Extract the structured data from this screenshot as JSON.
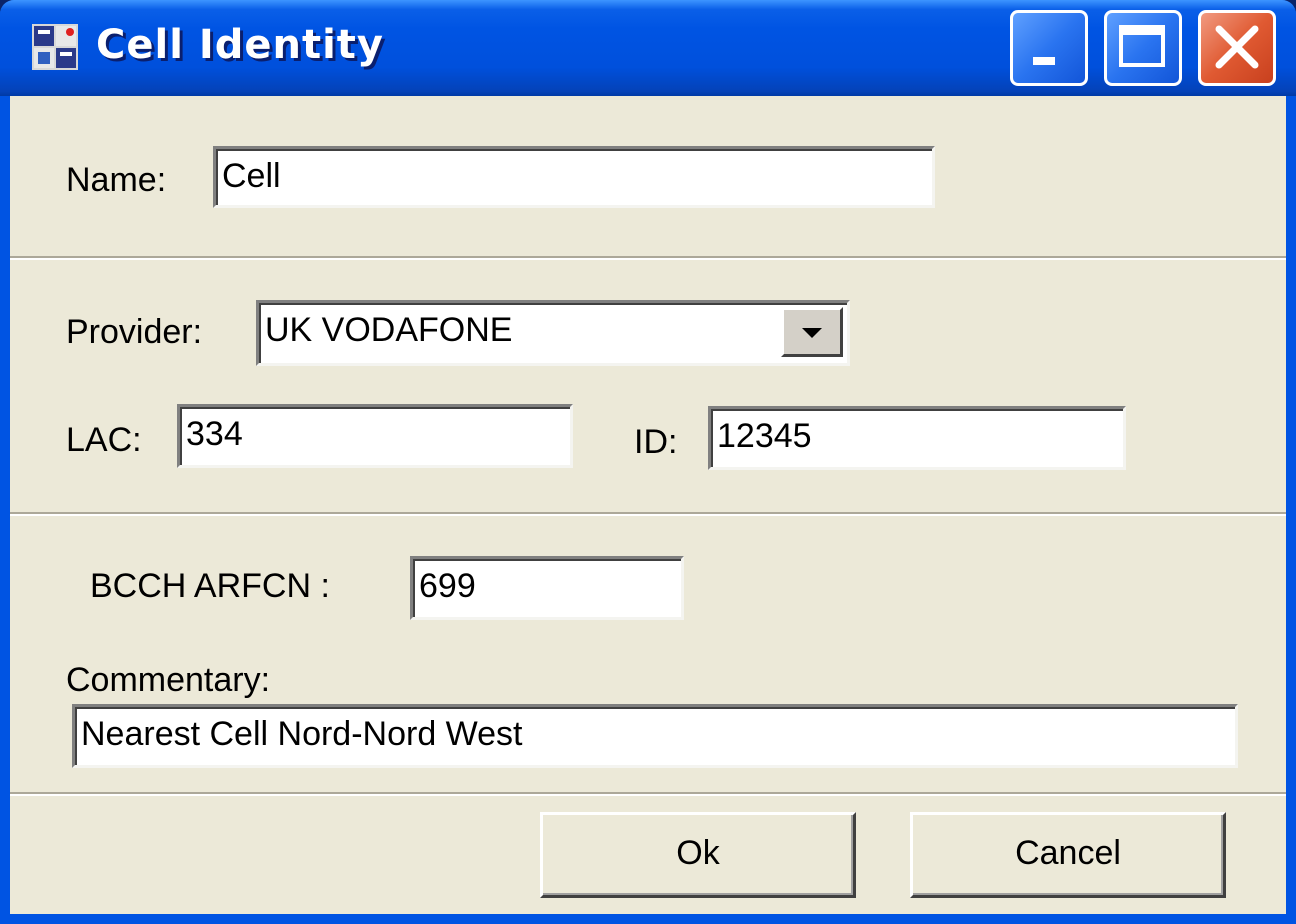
{
  "window": {
    "title": "Cell Identity",
    "controls": {
      "minimize": "minimize",
      "maximize": "maximize",
      "close": "close"
    }
  },
  "form": {
    "name_label": "Name:",
    "name_value": "Cell",
    "provider_label": "Provider:",
    "provider_value": "UK VODAFONE",
    "lac_label": "LAC:",
    "lac_value": "334",
    "id_label": "ID:",
    "id_value": "12345",
    "bcch_label": "BCCH ARFCN :",
    "bcch_value": "699",
    "commentary_label": "Commentary:",
    "commentary_value": "Nearest Cell Nord-Nord West"
  },
  "buttons": {
    "ok_label": "Ok",
    "cancel_label": "Cancel"
  },
  "icons": {
    "app": "app-icon",
    "dropdown": "chevron-down-icon"
  },
  "colors": {
    "titlebar": "#0054e3",
    "client_bg": "#ece9d8",
    "close_button": "#e05a32"
  }
}
